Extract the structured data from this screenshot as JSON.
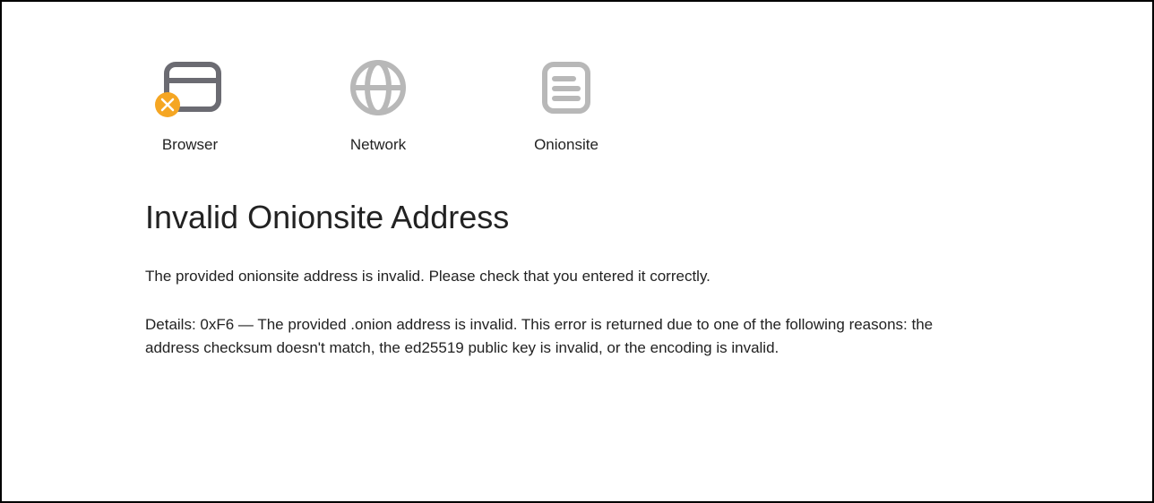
{
  "icons": {
    "browser": {
      "label": "Browser"
    },
    "network": {
      "label": "Network"
    },
    "onionsite": {
      "label": "Onionsite"
    }
  },
  "error": {
    "title": "Invalid Onionsite Address",
    "description": "The provided onionsite address is invalid. Please check that you entered it correctly.",
    "details": "Details: 0xF6 — The provided .onion address is invalid. This error is returned due to one of the following reasons: the address checksum doesn't match, the ed25519 public key is invalid, or the encoding is invalid."
  }
}
